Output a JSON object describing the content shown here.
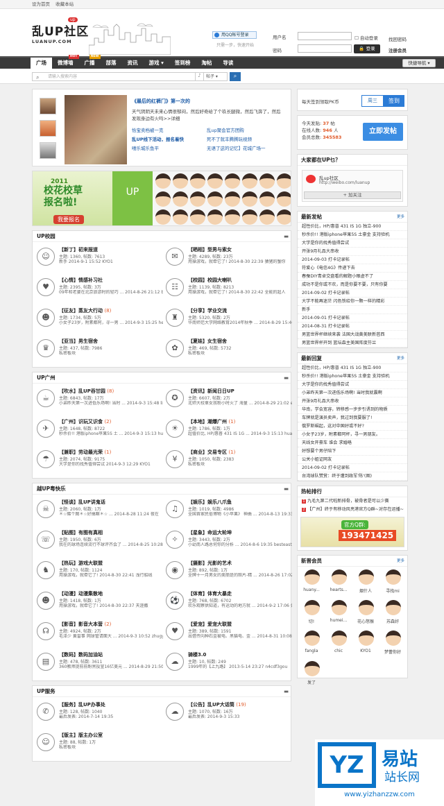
{
  "topbar": {
    "set_home": "设为首页",
    "bookmark": "收藏本站"
  },
  "logo": {
    "cn": "乱UP社区",
    "en": "LUANUP.COM",
    "up": "up"
  },
  "qq": {
    "button": "用QQ帐号登录",
    "tip": "只需一步，快速开始"
  },
  "login": {
    "user_label": "用户名",
    "pass_label": "密码",
    "select_value": "用户名",
    "auto": "自动登录",
    "find": "找回密码",
    "register": "注册会员",
    "button": "登录"
  },
  "nav": {
    "items": [
      {
        "label": "广场",
        "active": true
      },
      {
        "label": "微博墙",
        "badge": "HOT",
        "badge_color": "#d33"
      },
      {
        "label": "广播",
        "badge": "NEW",
        "badge_color": "#e8a000"
      },
      {
        "label": "部落"
      },
      {
        "label": "资讯"
      },
      {
        "label": "游戏 ▾"
      },
      {
        "label": "签到榜"
      },
      {
        "label": "淘帖"
      },
      {
        "label": "导读"
      }
    ],
    "fast": "快捷导航 ▾"
  },
  "search": {
    "placeholder": "请输入搜索内容",
    "select": "帖子 ▾",
    "button": "⌕"
  },
  "feature": {
    "title": "《最后的红裤门》第一次的",
    "desc": "天气阴阴天未来心情很郁闷，然后好奇给了个玖长腿微，然后飞奔了，然后发现身边有火吗>>详细",
    "links": [
      "恰宝卖档被一克",
      "乱up聚会官方团购",
      "乱UP线下活动，报名着快",
      "死不了就丰腾腾玩视频",
      "嘻乐城乐鱼平",
      "无语了这的记忆】花城广场一"
    ]
  },
  "banner": {
    "year": "2011",
    "title": "校花校草\n报名啦!",
    "button": "我要报名",
    "up": "UP"
  },
  "sections": [
    {
      "title": "UP校园",
      "forums": [
        {
          "icon": "☺",
          "name": "【新丁】初来报道",
          "stats": "主题: 1360, 帖数: 7613",
          "last": "新手 2014-9-1 15:52 KYO1"
        },
        {
          "icon": "✉",
          "name": "【晒相】型男与索女",
          "stats": "主题: 4289, 帖数: 23万",
          "last": "用操游戏，就牵它了! 2014-8-30 22:39 猿猪的蟹你"
        },
        {
          "icon": "♥",
          "name": "【心情】情感补习社",
          "stats": "主题: 2395, 帖数: 3万",
          "last": "09年和老婆在北京旅游时的轻巧 ... 2014-8-26 21:12 bailo5200"
        },
        {
          "icon": "☷",
          "name": "【校园】校园大喇叭",
          "stats": "主题: 1139, 帖数: 8213",
          "last": "用操游戏，就牵它了! 2014-8-30 22:42 全能的超人"
        },
        {
          "icon": "☻",
          "name": "【征友】蒸友大行动",
          "count": "(8)",
          "stats": "主题: 1734, 帖数: 5万",
          "last": "小女子23岁，附素都阿，寻一男 ... 2014-9-3 15:25 heartspeak"
        },
        {
          "icon": "♜",
          "name": "【分享】学业交流",
          "stats": "主题: 5320, 帖数: 2万",
          "last": "华南师范大学网络教育2014年秋季 ... 2014-8-29 15:40 ◇ Lynn。"
        },
        {
          "icon": "♛",
          "name": "【亚当】男生宿舍",
          "stats": "主题: 437, 帖数: 7986",
          "last": "私密板块"
        },
        {
          "icon": "✿",
          "name": "【夏娃】女生宿舍",
          "stats": "主题: 469, 帖数: 5732",
          "last": "私密板块"
        }
      ]
    },
    {
      "title": "UP广州",
      "forums": [
        {
          "icon": "☕",
          "name": "【吹水】乱UP吞甘园",
          "count": "(8)",
          "stats": "主题: 6843, 帖数: 17万",
          "last": "小弟昨天第一次进低乐场啊! 当时 ... 2014-9-3 15:48 lisa0000"
        },
        {
          "icon": "✪",
          "name": "【资讯】新闻日日UP",
          "stats": "主题: 6607, 帖数: 2万",
          "last": "北师大校車女孩粉小时火了 海量 ... 2014-8-29 21:02 evanlou"
        },
        {
          "icon": "✈",
          "name": "【广州】识玩又识食",
          "count": "(2)",
          "stats": "主题: 1648, 帖数: 8722",
          "last": "秒杀价!! 港版iphone苹果5S 土 ... 2014-9-3 15:13 huanyu0908"
        },
        {
          "icon": "☀",
          "name": "【本地】潮爆广州",
          "count": "(1)",
          "stats": "主题: 1786, 帖数: 1万",
          "last": "超值价比, HP/惠普 431 IS 1G ... 2014-9-3 15:13 huanyu0908"
        },
        {
          "icon": "☂",
          "name": "【兼职】劳动最光荣",
          "count": "(1)",
          "stats": "主题: 2074, 帖数: 9175",
          "last": "大学是你的找秀值得尝试 2014-9-3 12:29 KYO1"
        },
        {
          "icon": "¥",
          "name": "【商业】交易专区",
          "count": "(1)",
          "stats": "主题: 1050, 帖数: 2383",
          "last": "私密板块"
        }
      ]
    },
    {
      "title": "越UP粤快乐",
      "forums": [
        {
          "icon": "☠",
          "name": "【怪谈】乱UP讲鬼话",
          "stats": "主题: 2060, 帖数: 1万",
          "last": "＊☆睇个图＊☆好搞嘛＊☆ ... 2014-8-28 11:24 夜在"
        },
        {
          "icon": "♫",
          "name": "【娱乐】娱乐八爪鱼",
          "stats": "主题: 1019, 帖数: 4986",
          "last": "全国首家民俗博物《小苹果》 神曲 ... 2014-8-13 19:33 渴雷检哥"
        },
        {
          "icon": "☏",
          "name": "【贴图】有图有真相",
          "stats": "主题: 1950, 帖数: 6万",
          "last": "我在的球场连续流行不球评齐会了 ... 2014-8-25 10:28 Aodojan"
        },
        {
          "icon": "✧",
          "name": "【星象】命运大轮坤",
          "stats": "主题: 3443, 帖数: 2万",
          "last": "小幼南人路总何你的分析 ... 2014-8-6 19:35 besteast"
        },
        {
          "icon": "♞",
          "name": "【热玩】游戏大联盟",
          "stats": "主题: 170, 帖数: 1124",
          "last": "用操游戏，就牵它了! 2014-8-30 22:41 浅行船线"
        },
        {
          "icon": "◉",
          "name": "【摄影】光影的艺术",
          "stats": "主题: 892, 帖数: 1万",
          "last": "全牌十一月男女的美丽是的照片-精 ... 2014-8-26 17:02 kyakwok"
        },
        {
          "icon": "☻",
          "name": "【动漫】动漫集散地",
          "stats": "主题: 1418, 帖数: 1万",
          "last": "用操游戏，就牵它了! 2014-8-30 22:37 天涯撒"
        },
        {
          "icon": "⚽",
          "name": "【体育】体育大暴走",
          "stats": "主题: 768, 帖数: 6702",
          "last": "欢乐观察供知道，有运动的地方就 ... 2014-9-2 17:06 如果妈阿"
        },
        {
          "icon": "☊",
          "name": "【影音】影音大本营",
          "count": "(2)",
          "stats": "主题: 4924, 帖数: 2万",
          "last": "毛泽少 黄雷事 网球管请面大 ... 2014-9-3 10:52 zhugy123"
        },
        {
          "icon": "♥",
          "name": "【爱宠】爱宠大联盟",
          "stats": "主题: 389, 帖数: 1591",
          "last": "出借传向种石金被电、黑猫电、金 ... 2014-8-31 10:08 hy2012"
        },
        {
          "icon": "▤",
          "name": "【数码】数码加油站",
          "stats": "主题: 478, 帖数: 3611",
          "last": "360教师提前前盼黑投宣16亿美元 ... 2014-8-29 21:50 DSHJ"
        },
        {
          "icon": "☁",
          "name": "骑楼3.0",
          "stats": "主题: 10, 帖数: 249",
          "last": "1999年的【上九路】 2013-5-14 23:27 n4cdf3gou"
        }
      ]
    },
    {
      "title": "UP服务",
      "forums": [
        {
          "icon": "✆",
          "name": "【服务】乱UP办事处",
          "stats": "主题: 128, 帖数: 1040",
          "last": "最后发表: 2014-7-14 19:35"
        },
        {
          "icon": "☁",
          "name": "【公告】乱UP大话筒",
          "count": "(19)",
          "stats": "主题: 1070, 帖数: 16万",
          "last": "最后发表: 2014-9-3 15:33"
        },
        {
          "icon": "☺",
          "name": "【版主】版主办公室",
          "stats": "主题: 88, 帖数: 1万",
          "last": "私密板块"
        }
      ]
    }
  ],
  "signin": {
    "text": "每天签到领取PK币",
    "day": "周三",
    "button": "签到"
  },
  "stats": {
    "today_label": "今天发贴:",
    "today": "37",
    "today_unit": "帖",
    "online_label": "在线人数:",
    "online": "946",
    "online_unit": "人",
    "members_label": "会员总数:",
    "members": "345583",
    "post": "立即发帖"
  },
  "weibo": {
    "head": "大家都在UP乜？",
    "name": "乱up社区",
    "url": "http://weibo.com/luanup",
    "add": "+ 加关注"
  },
  "latest_posts": {
    "head": "最新发帖",
    "more": "更多",
    "items": [
      "超性价比，HP/惠普 431 IS 1G 独立-900",
      "秒杀价!! 港版iphone苹果5S 土豪金 支持验机",
      "大学是你的找秀值得尝试",
      "开张9月礼品大串收",
      "2014-09-03 打卡记录帖",
      "符爱心《电信4G》传递下去",
      "春蚕DIY青卓交盘看的解题小眼虚不了",
      "成功不是你或不欢，而是你要不要，只有你要",
      "2014-09-02 打卡记录帖",
      "大学不能再迷茫 闪色铁给你一颗一样的精彩",
      "新手",
      "2014-09-01 打卡记录帖",
      "2014-08-31 打卡记录帖",
      "男篮世界杯继续来袭 法国大战黄美联新芭西",
      "男篮世界杯开到 篮坛森主美国阵度芬兰"
    ]
  },
  "latest_replies": {
    "head": "最新回复",
    "more": "更多",
    "items": [
      "超性价比，HP/惠普 431 IS 1G 独立-900",
      "秒杀价!! 港版iphone苹果5S 土豪金 支持验机",
      "大学是你的找秀值得尝试",
      "小弟昨天第一次进低乐场啊! 当时我就震啊",
      "开张9月礼品大串收",
      "华南，学会宽容，转移感一步步引诱到的物质",
      "车牌就是演员卖声，我过到我要服了!",
      "俄罗斯崛起，这对中国好或不好?",
      "小女子23岁，附素都阿杯，寻一男朋友。",
      "天线女开豪车 谁会 求婚咯",
      "好想要个男仔陪下",
      "公关小姐证网友",
      "2014-09-02 打卡记录帖",
      "台湾球队赞赏：终于遭到政军'陈'(图)"
    ]
  },
  "hot": {
    "head": "热帖排行",
    "items": [
      "九毛九第二代啦新排骨，被骨者是可以少赛",
      "【广州】终于有移动风亮港官方Q群~对存在运播~"
    ]
  },
  "qqad": {
    "caption": "官方Q群:",
    "number": "193471425"
  },
  "new_members": {
    "head": "新晋会员",
    "more": "更多",
    "items": [
      "huany...",
      "hearts...",
      "烟什人",
      "寻找mi",
      "切!",
      "humei...",
      "花心怒猴",
      "苏森好",
      "fangla",
      "chic",
      "KYO1",
      "梦蕾你好",
      "发了"
    ]
  },
  "watermark": {
    "big": "YZ",
    "yi": "易站",
    "zz": "站长网",
    "url": "www.yizhanzzw.com"
  }
}
